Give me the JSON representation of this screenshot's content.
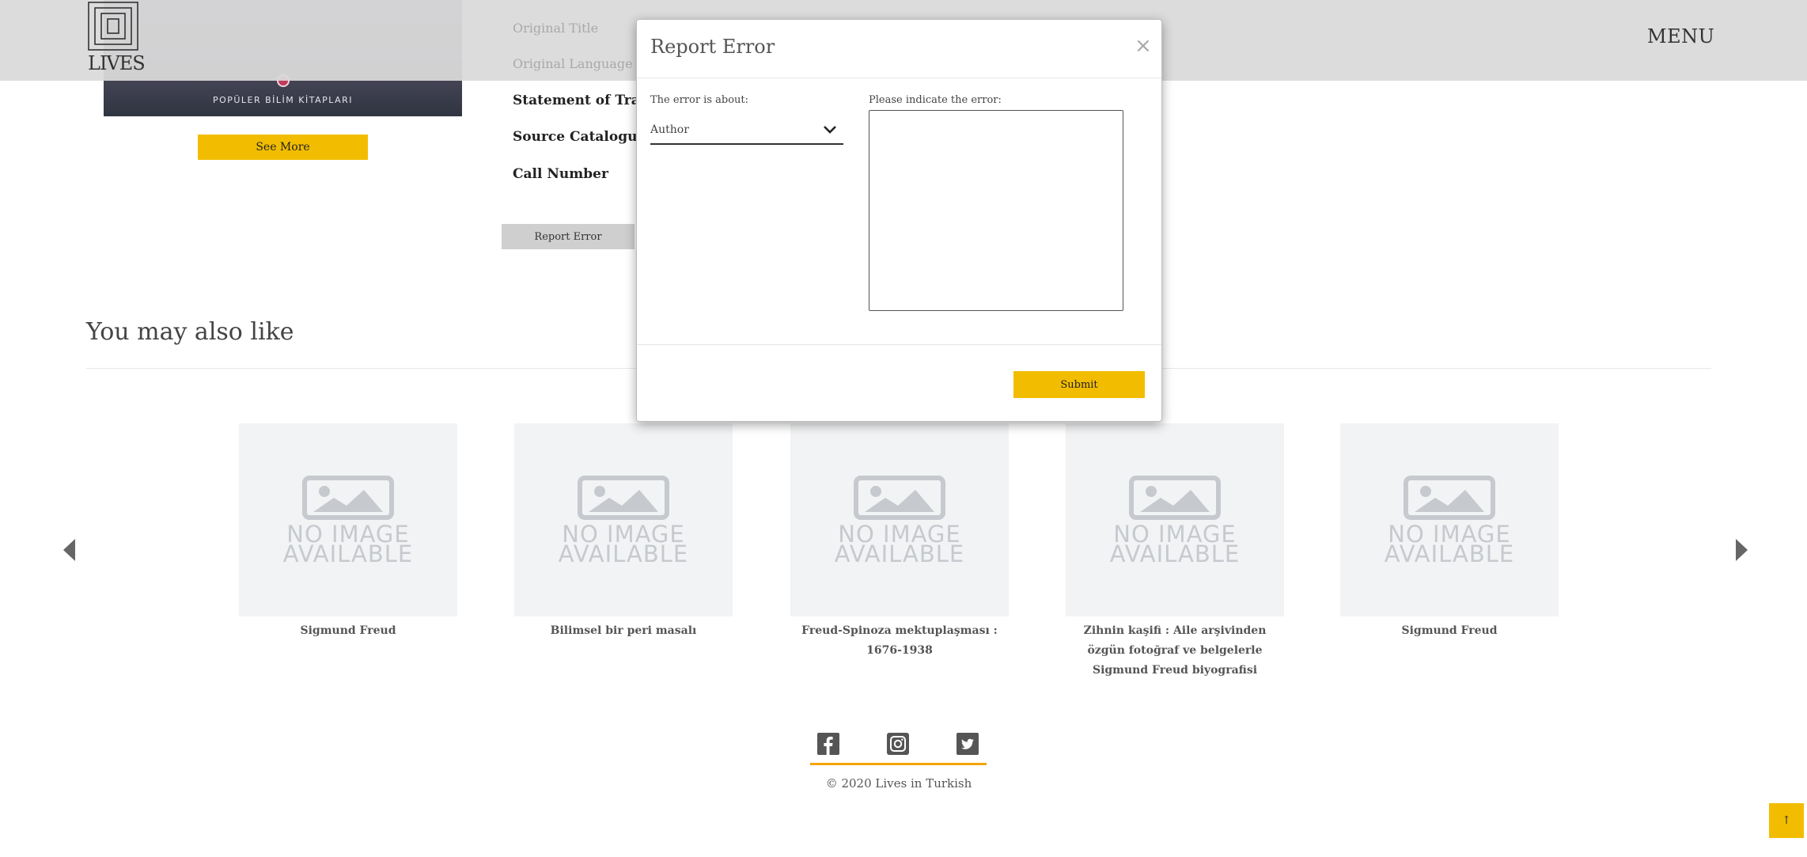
{
  "header": {
    "logo_text": "LIVES",
    "menu_label": "MENU"
  },
  "book": {
    "cover_series_text": "POPÜLER BİLİM KİTAPLARI",
    "see_more_label": "See More",
    "fields": {
      "original_title": "Original Title",
      "original_language": "Original Language",
      "statement_of_translation": "Statement of Translati",
      "source_catalogue": "Source Catalogue",
      "call_number": "Call Number"
    },
    "report_error_label": "Report Error"
  },
  "related": {
    "title": "You may also like",
    "no_image_line1": "NO IMAGE",
    "no_image_line2": "AVAILABLE",
    "items": [
      {
        "caption": "Sigmund Freud"
      },
      {
        "caption": "Bilimsel bir peri masalı"
      },
      {
        "caption": "Freud-Spinoza mektuplaşması : 1676-1938"
      },
      {
        "caption": "Zihnin kaşifi : Aile arşivinden özgün fotoğraf ve belgelerle Sigmund Freud biyografisi"
      },
      {
        "caption": "Sigmund Freud"
      }
    ]
  },
  "footer": {
    "social": [
      "facebook-icon",
      "instagram-icon",
      "twitter-icon"
    ],
    "copyright": "© 2020 Lives in Turkish",
    "accent_color": "#f2a400"
  },
  "modal": {
    "title": "Report Error",
    "close_symbol": "×",
    "about_label": "The error is about:",
    "about_value": "Author",
    "indicate_label": "Please indicate the error:",
    "indicate_value": "",
    "submit_label": "Submit"
  },
  "to_top_symbol": "↑",
  "colors": {
    "accent_yellow": "#f2bd00",
    "header_bg": "#dadada"
  }
}
